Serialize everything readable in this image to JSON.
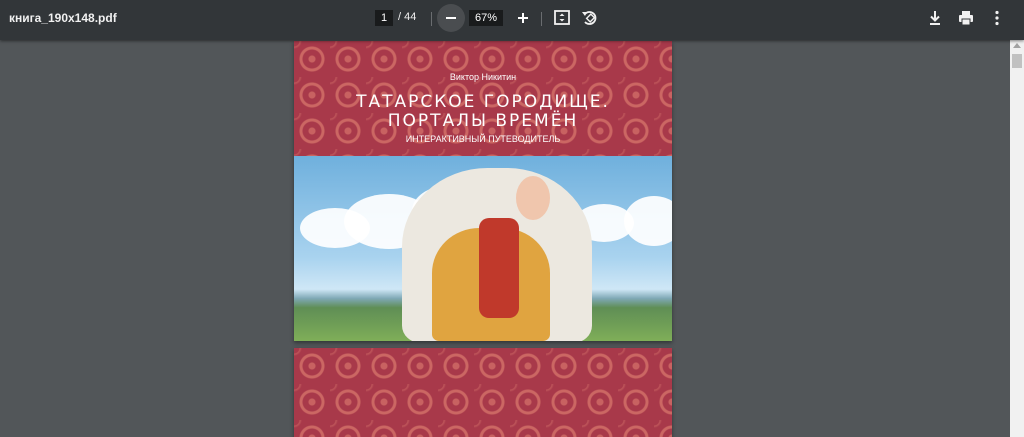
{
  "toolbar": {
    "file_name": "книга_190x148.pdf",
    "current_page": "1",
    "page_separator": "/",
    "total_pages": "44",
    "zoom": "67%",
    "icons": [
      "zoom-out-icon",
      "zoom-in-icon",
      "fit-page-icon",
      "rotate-icon",
      "download-icon",
      "print-icon",
      "more-icon"
    ]
  },
  "document": {
    "author": "Виктор Никитин",
    "title_line1": "Татарское городище.",
    "title_line2": "Порталы времён",
    "subtitle": "ИНТЕРАКТИВНЫЙ ПУТЕВОДИТЕЛЬ"
  },
  "colors": {
    "toolbar": "#323639",
    "viewer_background": "#525659",
    "cover_red": "#a8394a"
  }
}
